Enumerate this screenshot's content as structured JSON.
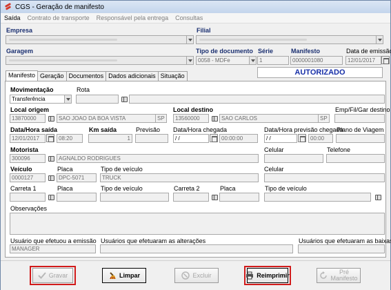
{
  "window": {
    "title": "CGS - Geração de manifesto"
  },
  "menu": [
    {
      "label": "Saída",
      "enabled": true
    },
    {
      "label": "Contrato de transporte",
      "enabled": false
    },
    {
      "label": "Responsável pela entrega",
      "enabled": false
    },
    {
      "label": "Consultas",
      "enabled": false
    }
  ],
  "header": {
    "empresa_label": "Empresa",
    "filial_label": "Filial",
    "garagem_label": "Garagem",
    "tipo_doc_label": "Tipo de documento",
    "tipo_doc_value": "0058 - MDFe",
    "serie_label": "Série",
    "serie_value": "1",
    "manifesto_label": "Manifesto",
    "manifesto_value": "0000001080",
    "data_emissao_label": "Data de emissão",
    "data_emissao_value": "12/01/2017",
    "status": "AUTORIZADO"
  },
  "tabs": [
    {
      "label": "Manifesto"
    },
    {
      "label": "Geração"
    },
    {
      "label": "Documentos"
    },
    {
      "label": "Dados adicionais"
    },
    {
      "label": "Situação"
    }
  ],
  "form": {
    "movimentacao_label": "Movimentação",
    "movimentacao_value": "Transferência",
    "rota_label": "Rota",
    "local_origem_label": "Local origem",
    "origem_code": "13870000",
    "origem_name": "SAO JOAO DA BOA VISTA",
    "origem_uf": "SP",
    "local_destino_label": "Local destino",
    "destino_code": "13560000",
    "destino_name": "SAO CARLOS",
    "destino_uf": "SP",
    "emp_fil_gar_label": "Emp/Fil/Gar destino",
    "data_hora_saida_label": "Data/Hora saída",
    "data_saida": "12/01/2017",
    "hora_saida": "08:20",
    "km_saida_label": "Km saída",
    "km_saida_value": "1",
    "previsao_label": "Previsão",
    "data_hora_chegada_label": "Data/Hora chegada",
    "data_chegada": "/ /",
    "hora_chegada": "00:00:00",
    "data_hora_prev_label": "Data/Hora previsão chegada",
    "data_prev": "/ /",
    "hora_prev": "00:00",
    "plano_viagem_label": "Plano de Viagem",
    "motorista_label": "Motorista",
    "motorista_code": "300096",
    "motorista_name": "AGNALDO RODRIGUES",
    "celular_label": "Celular",
    "telefone_label": "Telefone",
    "veiculo_label": "Veículo",
    "veiculo_code": "0000127",
    "placa_label": "Placa",
    "veiculo_placa": "DPC-5071",
    "tipo_veiculo_label": "Tipo de veículo",
    "tipo_veiculo_value": "TRUCK",
    "celular2_label": "Celular",
    "carreta1_label": "Carreta 1",
    "placa2_label": "Placa",
    "tipo_veiculo2_label": "Tipo de veículo",
    "carreta2_label": "Carreta 2",
    "placa3_label": "Placa",
    "tipo_veiculo3_label": "Tipo de veículo",
    "observacoes_label": "Observações",
    "usuario_emissao_label": "Usuário que efetuou a emissão",
    "usuario_emissao_value": "MANAGER",
    "usuarios_alteracoes_label": "Usuários que efetuaram as alterações",
    "usuarios_baixas_label": "Usuários que efetuaram as baixas"
  },
  "buttons": {
    "gravar": "Gravar",
    "limpar": "Limpar",
    "excluir": "Excluir",
    "reimprimir": "Reimprimir",
    "pre_manifesto_1": "Pré",
    "pre_manifesto_2": "Manifesto"
  },
  "colors": {
    "status_text": "#1830a8",
    "highlight": "#d11a1a",
    "label_bold": "#1a2f70"
  }
}
